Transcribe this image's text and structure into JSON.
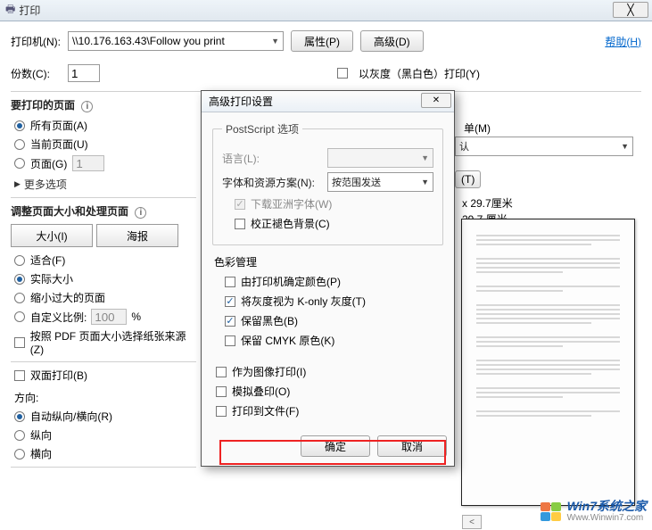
{
  "titlebar": {
    "title": "打印"
  },
  "printer": {
    "label": "打印机(N):",
    "value": "\\\\10.176.163.43\\Follow you print",
    "properties_btn": "属性(P)",
    "advanced_btn": "高级(D)",
    "help_link": "帮助(H)"
  },
  "copies": {
    "label": "份数(C):",
    "value": "1"
  },
  "grayscale": {
    "label": "以灰度（黑白色）打印(Y)"
  },
  "pages_section": {
    "heading": "要打印的页面",
    "all": "所有页面(A)",
    "current": "当前页面(U)",
    "pages_label": "页面(G)",
    "pages_value": "1",
    "more": "更多选项"
  },
  "resize_section": {
    "heading": "调整页面大小和处理页面",
    "size_btn": "大小(I)",
    "poster_btn": "海报",
    "fit": "适合(F)",
    "actual": "实际大小",
    "shrink": "缩小过大的页面",
    "custom_label": "自定义比例:",
    "custom_value": "100",
    "custom_pct": "%",
    "choose_paper": "按照 PDF 页面大小选择纸张来源(Z)"
  },
  "duplex": {
    "label": "双面打印(B)"
  },
  "orientation": {
    "heading": "方向:",
    "auto": "自动纵向/横向(R)",
    "portrait": "纵向",
    "landscape": "横向"
  },
  "right": {
    "unitM": "单(M)",
    "default": "认",
    "hintT": "(T)",
    "size1": "x 29.7厘米",
    "size2": "29.7 厘米"
  },
  "modal": {
    "title": "高级打印设置",
    "ps_section": "PostScript 选项",
    "lang_label": "语言(L):",
    "font_label": "字体和资源方案(N):",
    "font_value": "按范围发送",
    "download_fonts": "下载亚洲字体(W)",
    "discolor_bg": "校正褪色背景(C)",
    "color_section": "色彩管理",
    "color_printer": "由打印机确定颜色(P)",
    "color_konly": "将灰度视为 K-only 灰度(T)",
    "color_black": "保留黑色(B)",
    "color_cmyk": "保留 CMYK 原色(K)",
    "as_image": "作为图像打印(I)",
    "simulate": "模拟叠印(O)",
    "to_file": "打印到文件(F)",
    "ok": "确定",
    "cancel": "取消"
  },
  "watermark": {
    "brand": "Win7系统之家",
    "url": "Www.Winwin7.com"
  }
}
